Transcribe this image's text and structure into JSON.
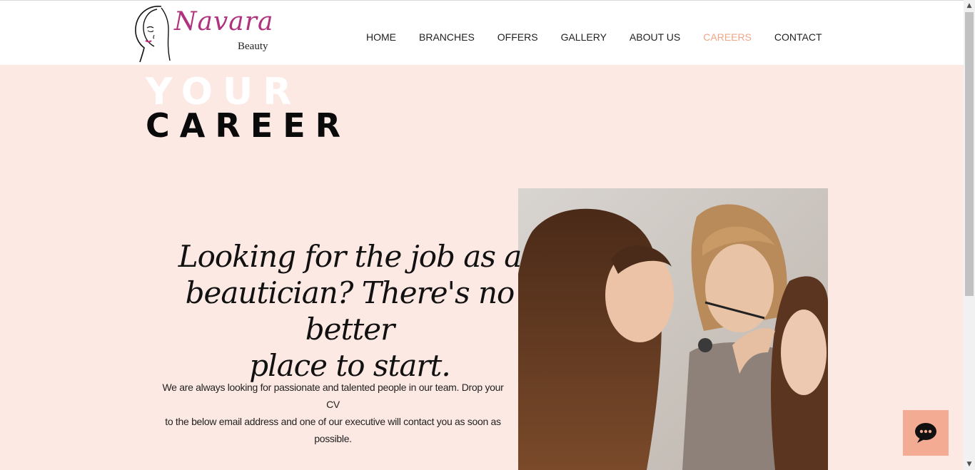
{
  "brand": {
    "name": "Navara",
    "sub": "Beauty"
  },
  "nav": {
    "items": [
      {
        "label": "HOME"
      },
      {
        "label": "BRANCHES"
      },
      {
        "label": "OFFERS"
      },
      {
        "label": "GALLERY"
      },
      {
        "label": "ABOUT US"
      },
      {
        "label": "CAREERS"
      },
      {
        "label": "CONTACT"
      }
    ],
    "active": "CAREERS"
  },
  "hero": {
    "title_line1": "YOUR",
    "title_line2": "CAREER",
    "headline_line1": "Looking for the job as a",
    "headline_line2": "beautician? There's no better",
    "headline_line3": "place to start.",
    "body_line1": "We are always looking for passionate and talented people in our team. Drop your CV",
    "body_line2": "to the below email address and one of our executive will contact you as soon as",
    "body_line3": "possible."
  },
  "colors": {
    "hero_background": "#fde9e3",
    "active_nav": "#f0a687",
    "brand": "#b0327e",
    "chat_button": "#f4ab93"
  },
  "icons": {
    "chat": "chat-bubble-icon",
    "logo": "woman-face-icon"
  }
}
